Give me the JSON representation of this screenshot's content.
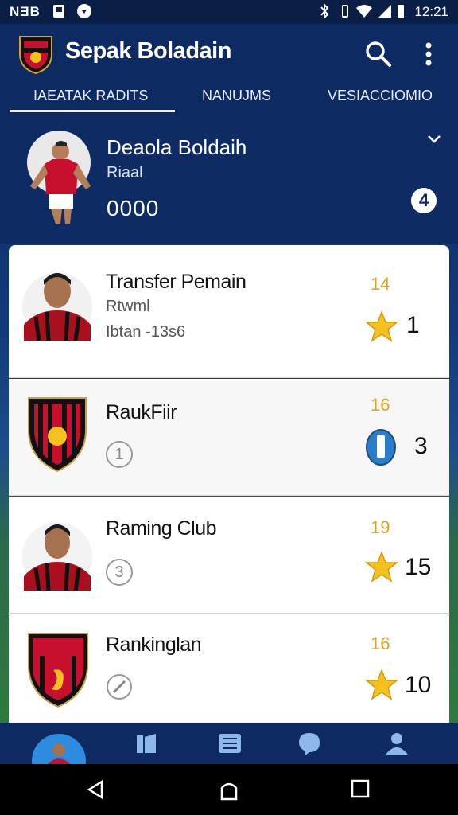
{
  "status_bar": {
    "left_text": "NƎB",
    "time": "12:21"
  },
  "app_bar": {
    "title": "Sepak Boladain"
  },
  "tabs": [
    {
      "label": "IAEATAK RADITS",
      "active": true
    },
    {
      "label": "NANUJMS",
      "active": false
    },
    {
      "label": "VESIACCIOMIO",
      "active": false
    }
  ],
  "profile": {
    "name": "Deaola Boldaih",
    "subtitle": "Riaal",
    "number": "0000",
    "badge": "4"
  },
  "cards": [
    {
      "title": "Transfer Pemain",
      "line1": "Rtwml",
      "line2": "Ibtan -13s6",
      "rank": "14",
      "value": "1",
      "icon": "star-icon"
    },
    {
      "title": "RaukFiir",
      "circle": "1",
      "rank": "16",
      "value": "3",
      "icon": "shield-badge-icon"
    },
    {
      "title": "Raming Club",
      "circle": "3",
      "rank": "19",
      "value": "15",
      "icon": "star-icon"
    },
    {
      "title": "Rankinglan",
      "circle": "",
      "rank": "16",
      "value": "10",
      "icon": "star-icon"
    }
  ],
  "colors": {
    "primary": "#0d2a62",
    "accent_star": "#f3c21f",
    "rank_text": "#e0a21c"
  }
}
